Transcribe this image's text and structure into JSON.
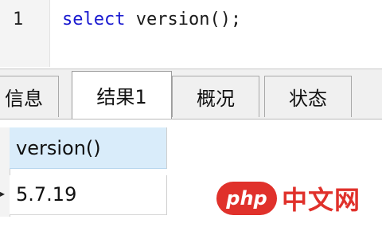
{
  "editor": {
    "line_number": "1",
    "code_keyword": "select",
    "code_rest": " version();"
  },
  "tabs": [
    {
      "label": "信息"
    },
    {
      "label": "结果1"
    },
    {
      "label": "概况"
    },
    {
      "label": "状态"
    }
  ],
  "result": {
    "column_header": "version()",
    "value": "5.7.19",
    "row_indicator": "▸"
  },
  "watermark": {
    "logo_text": "php",
    "text": "中文网"
  }
}
